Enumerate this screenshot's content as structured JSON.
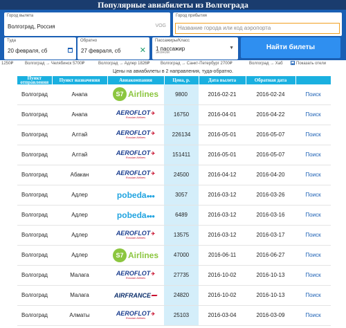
{
  "page": {
    "title": "Популярные авиабилеты из Волгограда"
  },
  "search": {
    "from_label": "Город вылета",
    "from_value": "Волгоград, Россия",
    "from_code": "VOG",
    "to_label": "Город прибытия",
    "to_placeholder": "Название города или код аэропорта",
    "depart_label": "Туда",
    "depart_value": "20 февраля, сб",
    "return_label": "Обратно",
    "return_value": "27 февраля, сб",
    "pax_label": "Пассажиры/Класс",
    "pax_value": "1 пассажир",
    "pax_class": "эконом",
    "find_label": "Найти билеты",
    "hints": [
      "1250₽",
      "Волгоград → Челябинск 5700₽",
      "Волгоград → Адлер 1826₽",
      "Волгоград → Санкт-Петербург 2700₽",
      "Волгоград → Хаб"
    ],
    "show_hotels": "Показать отели"
  },
  "note": "Цены на авиабилеты в 2 направления, туда-обратно.",
  "table": {
    "headers": [
      "Пункт отправления",
      "Пункт назначения",
      "Авиакомпания",
      "Цена, р.",
      "Дата вылета",
      "Обратная дата",
      ""
    ],
    "rows": [
      {
        "from": "Волгоград",
        "to": "Анапа",
        "airline": "s7",
        "price": "9800",
        "depart": "2016-02-21",
        "return": "2016-02-24",
        "link": "Поиск"
      },
      {
        "from": "Волгоград",
        "to": "Анапа",
        "airline": "aeroflot",
        "price": "16750",
        "depart": "2016-04-01",
        "return": "2016-04-22",
        "link": "Поиск"
      },
      {
        "from": "Волгоград",
        "to": "Алтай",
        "airline": "aeroflot",
        "price": "226134",
        "depart": "2016-05-01",
        "return": "2016-05-07",
        "link": "Поиск"
      },
      {
        "from": "Волгоград",
        "to": "Алтай",
        "airline": "aeroflot",
        "price": "151411",
        "depart": "2016-05-01",
        "return": "2016-05-07",
        "link": "Поиск"
      },
      {
        "from": "Волгоград",
        "to": "Абакан",
        "airline": "aeroflot",
        "price": "24500",
        "depart": "2016-04-12",
        "return": "2016-04-20",
        "link": "Поиск"
      },
      {
        "from": "Волгоград",
        "to": "Адлер",
        "airline": "pobeda",
        "price": "3057",
        "depart": "2016-03-12",
        "return": "2016-03-26",
        "link": "Поиск"
      },
      {
        "from": "Волгоград",
        "to": "Адлер",
        "airline": "pobeda",
        "price": "6489",
        "depart": "2016-03-12",
        "return": "2016-03-16",
        "link": "Поиск"
      },
      {
        "from": "Волгоград",
        "to": "Адлер",
        "airline": "aeroflot",
        "price": "13575",
        "depart": "2016-03-12",
        "return": "2016-03-17",
        "link": "Поиск"
      },
      {
        "from": "Волгоград",
        "to": "Адлер",
        "airline": "s7",
        "price": "47000",
        "depart": "2016-06-11",
        "return": "2016-06-27",
        "link": "Поиск"
      },
      {
        "from": "Волгоград",
        "to": "Малага",
        "airline": "aeroflot",
        "price": "27735",
        "depart": "2016-10-02",
        "return": "2016-10-13",
        "link": "Поиск"
      },
      {
        "from": "Волгоград",
        "to": "Малага",
        "airline": "airfrance",
        "price": "24820",
        "depart": "2016-10-02",
        "return": "2016-10-13",
        "link": "Поиск"
      },
      {
        "from": "Волгоград",
        "to": "Алматы",
        "airline": "aeroflot",
        "price": "25103",
        "depart": "2016-03-04",
        "return": "2016-03-09",
        "link": "Поиск"
      }
    ]
  },
  "logos": {
    "s7": {
      "mark": "S7",
      "name": "Airlines"
    },
    "aeroflot": {
      "name": "AEROFLOT",
      "sub": "Russian Airlines"
    },
    "pobeda": {
      "name": "pobeda",
      "dots": "●●●"
    },
    "airfrance": {
      "name": "AIRFRANCE"
    }
  }
}
